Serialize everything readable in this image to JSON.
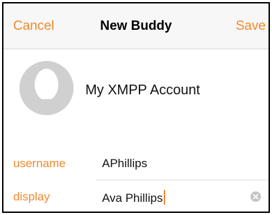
{
  "navbar": {
    "cancel_label": "Cancel",
    "title": "New Buddy",
    "save_label": "Save"
  },
  "account": {
    "name": "My XMPP Account",
    "avatar_icon": "person-silhouette-icon"
  },
  "fields": {
    "username": {
      "label": "username",
      "value": "APhillips"
    },
    "display": {
      "label": "display",
      "value": "Ava Phillips",
      "clear_icon": "clear-circle-icon"
    }
  },
  "colors": {
    "accent": "#f08a2c",
    "navbar_bg": "#f7f7f7",
    "avatar_gray": "#cfcfcf"
  }
}
